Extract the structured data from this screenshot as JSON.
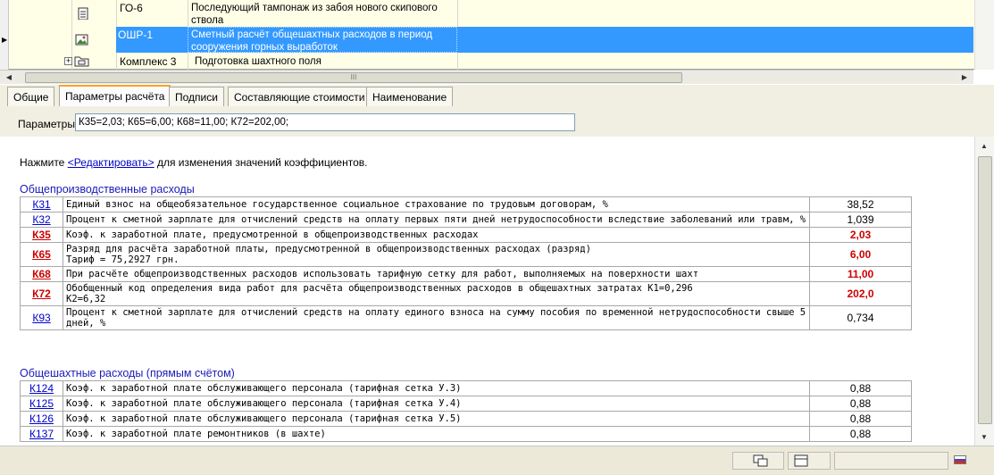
{
  "tree": {
    "rows": [
      {
        "code": "ГО-6",
        "name": "Последующий тампонаж из забоя нового скипового ствола"
      },
      {
        "code": "ОШР-1",
        "name": "Сметный расчёт общешахтных расходов в период сооружения горных выработок"
      },
      {
        "code": "Комплекс  3",
        "name": "Подготовка шахтного поля"
      }
    ],
    "scroll_mark": "III"
  },
  "tabs": [
    "Общие",
    "Параметры расчёта",
    "Подписи",
    "Составляющие стоимости",
    "Наименование"
  ],
  "params": {
    "label": "Параметры",
    "value": "К35=2,03; К65=6,00; К68=11,00; К72=202,00;"
  },
  "hint": {
    "prefix": "Нажмите ",
    "link": "<Редактировать>",
    "suffix": " для изменения значений коэффициентов."
  },
  "sections": [
    {
      "title": "Общепроизводственные расходы",
      "rows": [
        {
          "k": "К31",
          "desc": "Единый взнос на общеобязательное государственное социальное страхование по трудовым договорам, %",
          "val": "38,52",
          "red": false
        },
        {
          "k": "К32",
          "desc": "Процент к сметной зарплате для отчислений средств на оплату первых пяти дней нетрудоспособности вследствие заболеваний или травм, %",
          "val": "1,039",
          "red": false
        },
        {
          "k": "К35",
          "desc": "Коэф. к заработной плате, предусмотренной в общепроизводственных расходах",
          "val": "2,03",
          "red": true
        },
        {
          "k": "К65",
          "desc": "Разряд для расчёта заработной платы, предусмотренной в общепроизводственных расходах (разряд)\nТариф = 75,2927 грн.",
          "val": "6,00",
          "red": true
        },
        {
          "k": "К68",
          "desc": "При расчёте общепроизводственных расходов использовать тарифную сетку для работ, выполняемых на поверхности шахт",
          "val": "11,00",
          "red": true
        },
        {
          "k": "К72",
          "desc": "Обобщенный код определения вида работ для расчёта общепроизводственных расходов в общешахтных затратах К1=0,296\nК2=6,32",
          "val": "202,0",
          "red": true
        },
        {
          "k": "К93",
          "desc": "Процент к сметной зарплате для отчислений средств на оплату единого взноса на сумму пособия по временной нетрудоспособности свыше 5 дней, %",
          "val": "0,734",
          "red": false
        }
      ]
    },
    {
      "title": "Общешахтные расходы (прямым счётом)",
      "rows": [
        {
          "k": "К124",
          "desc": "Коэф. к заработной плате обслуживающего персонала (тарифная сетка У.3)",
          "val": "0,88",
          "red": false
        },
        {
          "k": "К125",
          "desc": "Коэф. к заработной плате обслуживающего персонала (тарифная сетка У.4)",
          "val": "0,88",
          "red": false
        },
        {
          "k": "К126",
          "desc": "Коэф. к заработной плате обслуживающего персонала (тарифная сетка У.5)",
          "val": "0,88",
          "red": false
        },
        {
          "k": "К137",
          "desc": "Коэф. к заработной плате ремонтников (в шахте)",
          "val": "0,88",
          "red": false
        }
      ]
    }
  ],
  "colors": {
    "selection": "#3399ff",
    "link": "#0000cc",
    "changed": "#cc0000",
    "section": "#1a1ab8"
  },
  "icons": {
    "doc": "document-icon",
    "img": "image-icon",
    "folder": "folder-icon",
    "flag": "flag-icon"
  }
}
